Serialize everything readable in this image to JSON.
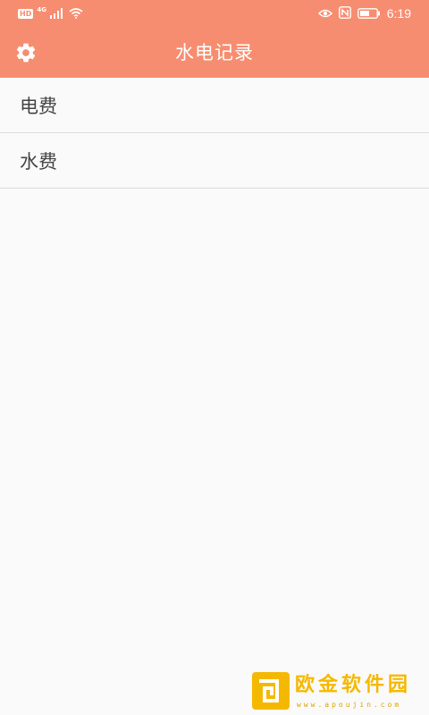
{
  "colors": {
    "header": "#f78d70",
    "background": "#fafafa",
    "divider": "#dcdcdc",
    "text": "#454545",
    "watermark": "#f5b800"
  },
  "status_bar": {
    "left_badge": "HD",
    "network_type": "4G",
    "time": "6:19",
    "icons": [
      "signal-icon",
      "wifi-icon",
      "eye-icon",
      "nfc-icon",
      "battery-icon"
    ]
  },
  "toolbar": {
    "title": "水电记录",
    "settings_icon": "gear-icon"
  },
  "list": {
    "items": [
      {
        "label": "电费"
      },
      {
        "label": "水费"
      }
    ]
  },
  "watermark": {
    "name": "欧金软件园",
    "url": "www.apoujin.com"
  }
}
